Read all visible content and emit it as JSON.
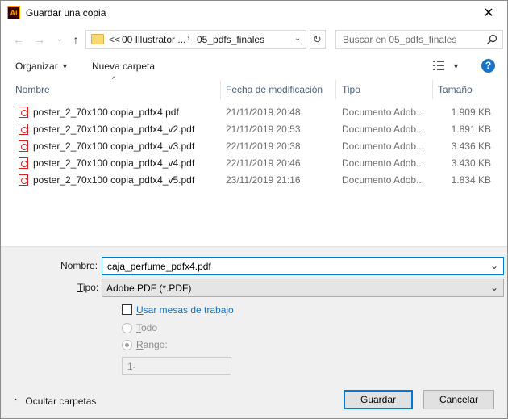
{
  "window": {
    "app_icon_text": "Ai",
    "title": "Guardar una copia",
    "close_glyph": "✕"
  },
  "nav": {
    "back_glyph": "←",
    "forward_glyph": "→",
    "recent_glyph": "⌄",
    "up_glyph": "↑",
    "address": {
      "overflow": "<<",
      "segment1": "00 Illustrator ...",
      "separator": "›",
      "segment2": "05_pdfs_finales",
      "dropdown_glyph": "⌄"
    },
    "refresh_glyph": "↻",
    "search_placeholder": "Buscar en 05_pdfs_finales"
  },
  "toolbar": {
    "organize_label": "Organizar",
    "new_folder_label": "Nueva carpeta",
    "help_glyph": "?"
  },
  "columns": {
    "name": "Nombre",
    "date": "Fecha de modificación",
    "type": "Tipo",
    "size": "Tamaño"
  },
  "files": [
    {
      "name": "poster_2_70x100 copia_pdfx4.pdf",
      "date": "21/11/2019 20:48",
      "type": "Documento Adob...",
      "size": "1.909 KB"
    },
    {
      "name": "poster_2_70x100 copia_pdfx4_v2.pdf",
      "date": "21/11/2019 20:53",
      "type": "Documento Adob...",
      "size": "1.891 KB"
    },
    {
      "name": "poster_2_70x100 copia_pdfx4_v3.pdf",
      "date": "22/11/2019 20:38",
      "type": "Documento Adob...",
      "size": "3.436 KB"
    },
    {
      "name": "poster_2_70x100 copia_pdfx4_v4.pdf",
      "date": "22/11/2019 20:46",
      "type": "Documento Adob...",
      "size": "3.430 KB"
    },
    {
      "name": "poster_2_70x100 copia_pdfx4_v5.pdf",
      "date": "23/11/2019 21:16",
      "type": "Documento Adob...",
      "size": "1.834 KB"
    }
  ],
  "form": {
    "name_label_prefix": "N",
    "name_label_ul": "o",
    "name_label_suffix": "mbre:",
    "name_value": "caja_perfume_pdfx4.pdf",
    "type_label_ul": "T",
    "type_label_suffix": "ipo:",
    "type_value": "Adobe PDF (*.PDF)",
    "artboards_ul": "U",
    "artboards_label": "sar mesas de trabajo",
    "all_ul": "T",
    "all_label": "odo",
    "range_ul": "R",
    "range_label": "ango:",
    "range_value": "1-"
  },
  "footer": {
    "hide_folders_label": "Ocultar carpetas",
    "save_ul": "G",
    "save_label": "uardar",
    "cancel_label": "Cancelar"
  }
}
